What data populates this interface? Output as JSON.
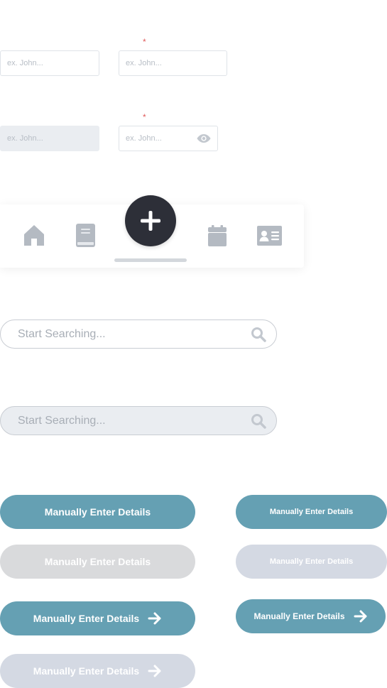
{
  "form": {
    "required_mark": "*",
    "row1": {
      "left_placeholder": "ex. John...",
      "right_placeholder": "ex. John..."
    },
    "row2": {
      "left_placeholder": "ex. John...",
      "right_placeholder": "ex. John...",
      "right_icon": "eye-icon"
    }
  },
  "navbar": {
    "items": [
      {
        "icon": "home-icon"
      },
      {
        "icon": "book-icon"
      },
      {
        "icon": "plus-icon"
      },
      {
        "icon": "calendar-icon"
      },
      {
        "icon": "contact-card-icon"
      }
    ]
  },
  "search": {
    "default_placeholder": "Start Searching...",
    "disabled_placeholder": "Start Searching...",
    "icon": "search-icon"
  },
  "buttons": {
    "large_primary": "Manually Enter Details",
    "large_disabled": "Manually Enter Details",
    "large_primary_arrow": "Manually Enter Details",
    "large_disabled_arrow": "Manually Enter Details",
    "small_primary": "Manually Enter Details",
    "small_disabled": "Manually Enter Details",
    "small_primary_arrow": "Manually Enter Details"
  },
  "colors": {
    "primary": "#65a0b3",
    "fab": "#2d2f38",
    "icon_grey": "#b4bac2",
    "required": "#e05a5a",
    "disabled_grey": "#d9dadc",
    "disabled_blue": "#d4d9e3"
  }
}
